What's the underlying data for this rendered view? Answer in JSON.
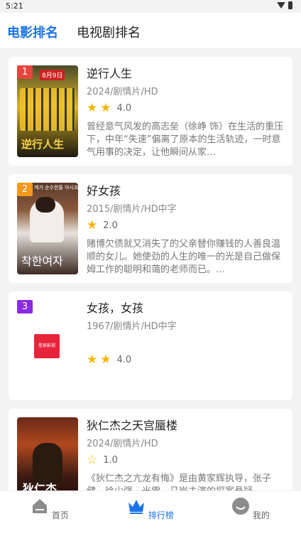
{
  "status": {
    "time": "5:21"
  },
  "header": {
    "tabs": [
      {
        "label": "电影排名"
      },
      {
        "label": "电视剧排名"
      }
    ]
  },
  "movies": [
    {
      "rank": "1",
      "rank_color": "#e8453c",
      "title": "逆行人生",
      "meta": "2024/剧情片/HD",
      "score": "4.0",
      "desc": "曾经意气风发的高志垒（徐峥 饰）在生活的重压下，中年“失速”偏离了原本的生活轨迹，一时意气用事的决定，让他瞬间从家…",
      "poster_text": "逆行人生",
      "poster_tag": "8月9日"
    },
    {
      "rank": "2",
      "rank_color": "#f39a1a",
      "title": "好女孩",
      "meta": "2015/剧情片/HD中字",
      "score": "2.0",
      "desc": "赌博欠债就又消失了的父亲替你赚钱的人善良温顺的女儿。她使劲的人生的唯一的光是自己做保姆工作的聪明和蔼的老师而已。…",
      "poster_text": "착한여자",
      "poster_tag": "계가 순수한줄 아시죠"
    },
    {
      "rank": "3",
      "rank_color": "#8a2be2",
      "title": "女孩，女孩",
      "meta": "1967/剧情片/HD中字",
      "score": "4.0",
      "desc": "",
      "poster_text": "星辰影视",
      "poster_tag": ""
    },
    {
      "rank": "",
      "rank_color": "",
      "title": "狄仁杰之天宫蜃楼",
      "meta": "2024/剧情片/HD",
      "score": "1.0",
      "desc": "《狄仁杰之亢龙有悔》是由黄家辉执导，张子健、徐少强、米雪、马岩主演的探案悬疑",
      "poster_text": "狄仁杰",
      "poster_tag": ""
    }
  ],
  "bottom_nav": [
    {
      "label": "首页",
      "icon": "home-icon"
    },
    {
      "label": "排行榜",
      "icon": "crown-icon"
    },
    {
      "label": "我的",
      "icon": "profile-icon"
    }
  ],
  "colors": {
    "accent": "#1a73e8",
    "star": "#f5b400"
  }
}
